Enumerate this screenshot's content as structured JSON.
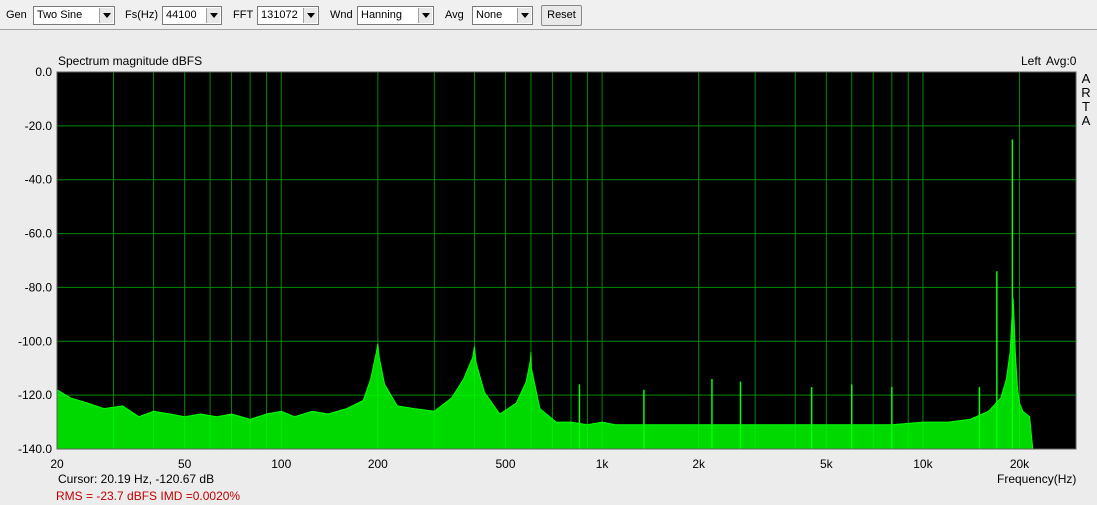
{
  "toolbar": {
    "gen_label": "Gen",
    "gen_value": "Two Sine",
    "fs_label": "Fs(Hz)",
    "fs_value": "44100",
    "fft_label": "FFT",
    "fft_value": "131072",
    "wnd_label": "Wnd",
    "wnd_value": "Hanning",
    "avg_label": "Avg",
    "avg_value": "None",
    "reset_label": "Reset"
  },
  "header": {
    "title": "Spectrum magnitude dBFS",
    "channel": "Left",
    "avg_count": "Avg:0",
    "brand_letters": [
      "A",
      "R",
      "T",
      "A"
    ]
  },
  "footer": {
    "cursor": "Cursor: 20.19 Hz, -120.67 dB",
    "stats": "RMS =  -23.7 dBFS   IMD =0.0020%",
    "xlabel": "Frequency(Hz)"
  },
  "colors": {
    "plot_bg": "#000000",
    "grid": "#008a00",
    "trace": "#00ff00",
    "stats_text": "#c00000"
  },
  "chart_data": {
    "type": "line",
    "title": "Spectrum magnitude dBFS",
    "xlabel": "Frequency(Hz)",
    "ylabel": "",
    "xscale": "log",
    "xlim": [
      20,
      30000
    ],
    "ylim": [
      -140,
      0
    ],
    "grid": true,
    "yticks": [
      0,
      -20,
      -40,
      -60,
      -80,
      -100,
      -120,
      -140
    ],
    "ytick_labels": [
      "0.0",
      "-20.0",
      "-40.0",
      "-60.0",
      "-80.0",
      "-100.0",
      "-120.0",
      "-140.0"
    ],
    "xticks": [
      20,
      50,
      100,
      200,
      500,
      1000,
      2000,
      5000,
      10000,
      20000
    ],
    "xtick_labels": [
      "20",
      "50",
      "100",
      "200",
      "500",
      "1k",
      "2k",
      "5k",
      "10k",
      "20k"
    ],
    "series": [
      {
        "x": [
          20,
          22,
          25,
          28,
          32,
          36,
          40,
          45,
          50,
          56,
          63,
          70,
          80,
          90,
          100,
          110,
          125,
          140,
          160,
          180,
          190,
          198,
          200,
          202,
          210,
          230,
          260,
          300,
          340,
          370,
          395,
          400,
          405,
          430,
          480,
          540,
          580,
          598,
          600,
          602,
          640,
          720,
          800,
          900,
          1000,
          1100,
          1300,
          1600,
          2000,
          2500,
          3000,
          4000,
          5000,
          6000,
          8000,
          10000,
          12000,
          14000,
          16000,
          17500,
          18200,
          18700,
          19000,
          19100,
          19200,
          19400,
          19700,
          20000,
          20500,
          21500,
          22000
        ],
        "y": [
          -118,
          -121,
          -123,
          -125,
          -124,
          -128,
          -126,
          -127,
          -128,
          -127,
          -128,
          -127,
          -129,
          -127,
          -126,
          -128,
          -126,
          -127,
          -125,
          -122,
          -114,
          -104,
          -101,
          -106,
          -116,
          -124,
          -125,
          -126,
          -121,
          -114,
          -106,
          -102,
          -108,
          -119,
          -127,
          -123,
          -115,
          -107,
          -104,
          -110,
          -125,
          -130,
          -130,
          -131,
          -130,
          -131,
          -131,
          -131,
          -131,
          -131,
          -131,
          -131,
          -131,
          -131,
          -131,
          -130,
          -130,
          -129,
          -126,
          -121,
          -114,
          -104,
          -88,
          -84,
          -89,
          -104,
          -117,
          -123,
          -126,
          -128,
          -140
        ]
      }
    ],
    "peaks": [
      {
        "x": 19000,
        "y": -25
      },
      {
        "x": 17000,
        "y": -74
      },
      {
        "x": 15000,
        "y": -117
      },
      {
        "x": 2200,
        "y": -114
      },
      {
        "x": 2700,
        "y": -115
      },
      {
        "x": 4500,
        "y": -117
      },
      {
        "x": 6000,
        "y": -116
      },
      {
        "x": 8000,
        "y": -117
      },
      {
        "x": 850,
        "y": -116
      },
      {
        "x": 1350,
        "y": -118
      }
    ]
  }
}
